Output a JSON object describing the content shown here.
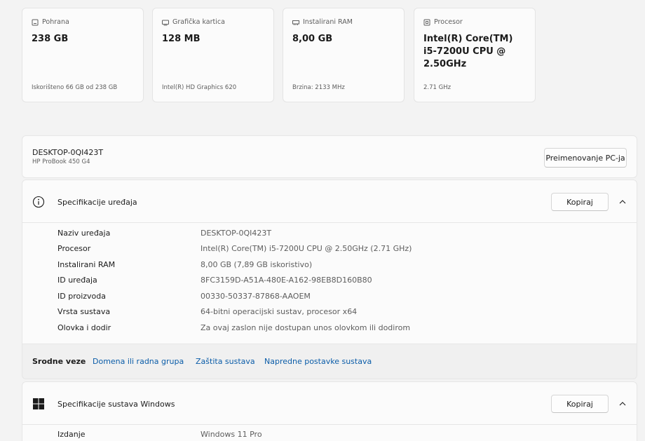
{
  "cards": [
    {
      "caption": "Pohrana",
      "value": "238 GB",
      "sub": "Iskorišteno 66 GB od 238 GB",
      "icon": "storage-icon"
    },
    {
      "caption": "Grafička kartica",
      "value": "128 MB",
      "sub": "Intel(R) HD Graphics 620",
      "icon": "gpu-icon"
    },
    {
      "caption": "Instalirani RAM",
      "value": "8,00 GB",
      "sub": "Brzina: 2133 MHz",
      "icon": "ram-icon"
    },
    {
      "caption": "Procesor",
      "value": "Intel(R) Core(TM) i5-7200U CPU @ 2.50GHz",
      "sub": "2.71 GHz",
      "icon": "cpu-icon"
    }
  ],
  "pc": {
    "name": "DESKTOP-0QI423T",
    "model": "HP ProBook 450 G4",
    "rename_label": "Preimenovanje PC-ja"
  },
  "device_specs": {
    "title": "Specifikacije uređaja",
    "copy_label": "Kopiraj",
    "rows": [
      {
        "label": "Naziv uređaja",
        "value": "DESKTOP-0QI423T"
      },
      {
        "label": "Procesor",
        "value": "Intel(R) Core(TM) i5-7200U CPU @ 2.50GHz (2.71 GHz)"
      },
      {
        "label": "Instalirani RAM",
        "value": "8,00 GB (7,89 GB iskoristivo)"
      },
      {
        "label": "ID uređaja",
        "value": "8FC3159D-A51A-480E-A162-98EB8D160B80"
      },
      {
        "label": "ID proizvoda",
        "value": "00330-50337-87868-AAOEM"
      },
      {
        "label": "Vrsta sustava",
        "value": "64-bitni operacijski sustav, procesor x64"
      },
      {
        "label": "Olovka i dodir",
        "value": "Za ovaj zaslon nije dostupan unos olovkom ili dodirom"
      }
    ]
  },
  "related": {
    "label": "Srodne veze",
    "links": [
      "Domena ili radna grupa",
      "Zaštita sustava",
      "Napredne postavke sustava"
    ]
  },
  "windows_specs": {
    "title": "Specifikacije sustava Windows",
    "copy_label": "Kopiraj",
    "rows": [
      {
        "label": "Izdanje",
        "value": "Windows 11 Pro"
      }
    ]
  },
  "colors": {
    "accent": "#0a5ca8",
    "windows_logo": "#1b1b1b"
  }
}
